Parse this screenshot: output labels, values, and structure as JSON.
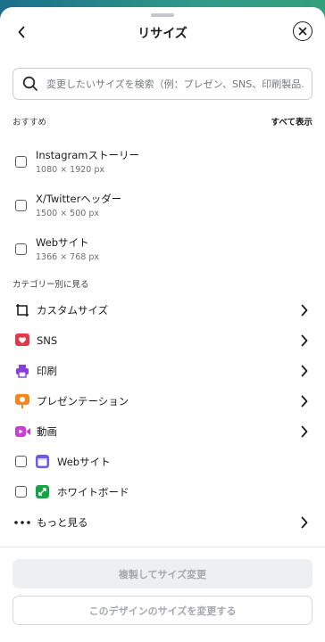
{
  "header": {
    "title": "リサイズ"
  },
  "search": {
    "placeholder": "変更したいサイズを検索（例：プレゼン、SNS、印刷製品..."
  },
  "recommended": {
    "heading": "おすすめ",
    "see_all": "すべて表示",
    "items": [
      {
        "name": "Instagramストーリー",
        "size": "1080 × 1920 px"
      },
      {
        "name": "X/Twitterヘッダー",
        "size": "1500 × 500 px"
      },
      {
        "name": "Webサイト",
        "size": "1366 × 768 px"
      }
    ]
  },
  "categories": {
    "heading": "カテゴリー別に見る",
    "items": [
      {
        "label": "カスタムサイズ",
        "icon": "custom-size-icon",
        "color": "#1c1c1f"
      },
      {
        "label": "SNS",
        "icon": "heart-icon",
        "color": "#e0394c"
      },
      {
        "label": "印刷",
        "icon": "printer-icon",
        "color": "#8b3fd9"
      },
      {
        "label": "プレゼンテーション",
        "icon": "presentation-icon",
        "color": "#f08a1c"
      },
      {
        "label": "動画",
        "icon": "video-icon",
        "color": "#c83fd6"
      }
    ],
    "subitems": [
      {
        "label": "Webサイト",
        "icon": "website-icon",
        "color": "#6b5ce7"
      },
      {
        "label": "ホワイトボード",
        "icon": "whiteboard-icon",
        "color": "#17a34a"
      }
    ],
    "more": "もっと見る"
  },
  "footer": {
    "duplicate_resize": "複製してサイズ変更",
    "resize_this": "このデザインのサイズを変更する"
  }
}
